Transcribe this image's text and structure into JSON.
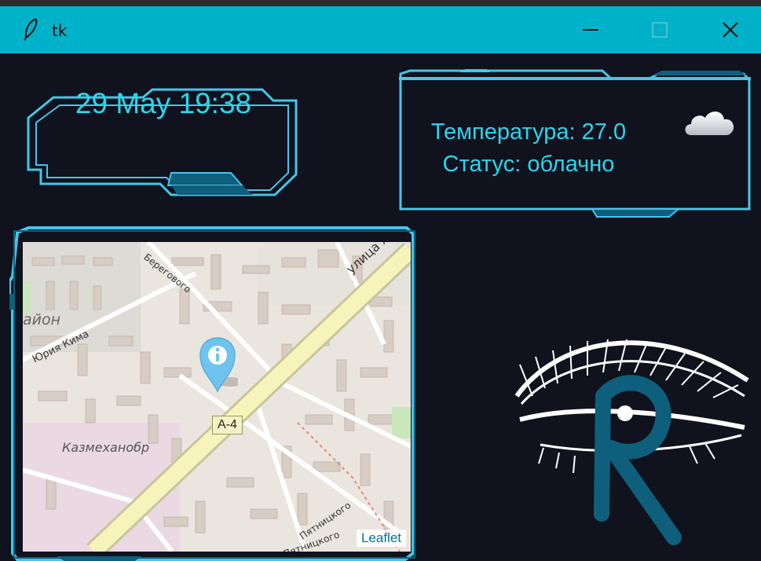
{
  "window": {
    "title": "tk",
    "controls": {
      "minimize": "minimize",
      "maximize": "maximize",
      "close": "close"
    }
  },
  "clock": {
    "text": "29 May 19:38"
  },
  "weather": {
    "temperature_line": "Температура: 27.0",
    "status_line": "Статус: облачно",
    "icon": "cloud-icon"
  },
  "map": {
    "attribution": "Leaflet",
    "labels": {
      "street_zhan": "улица Жан",
      "beregovogo": "Берегового",
      "yuriya_kima": "Юрия Кима",
      "rayon": "айон",
      "kazmekhanobr": "Казмеханобр",
      "pyatnitskogo": "Пятницкого",
      "pyatnitskogo2": "а Пятницкого",
      "road_a4": "А-4"
    },
    "marker_icon": "info-marker-icon"
  },
  "colors": {
    "titlebar": "#00b2c9",
    "background": "#10121e",
    "accent": "#2ad6ea",
    "frame": "#48c4e8",
    "eye_blue": "#0e5f7c"
  }
}
